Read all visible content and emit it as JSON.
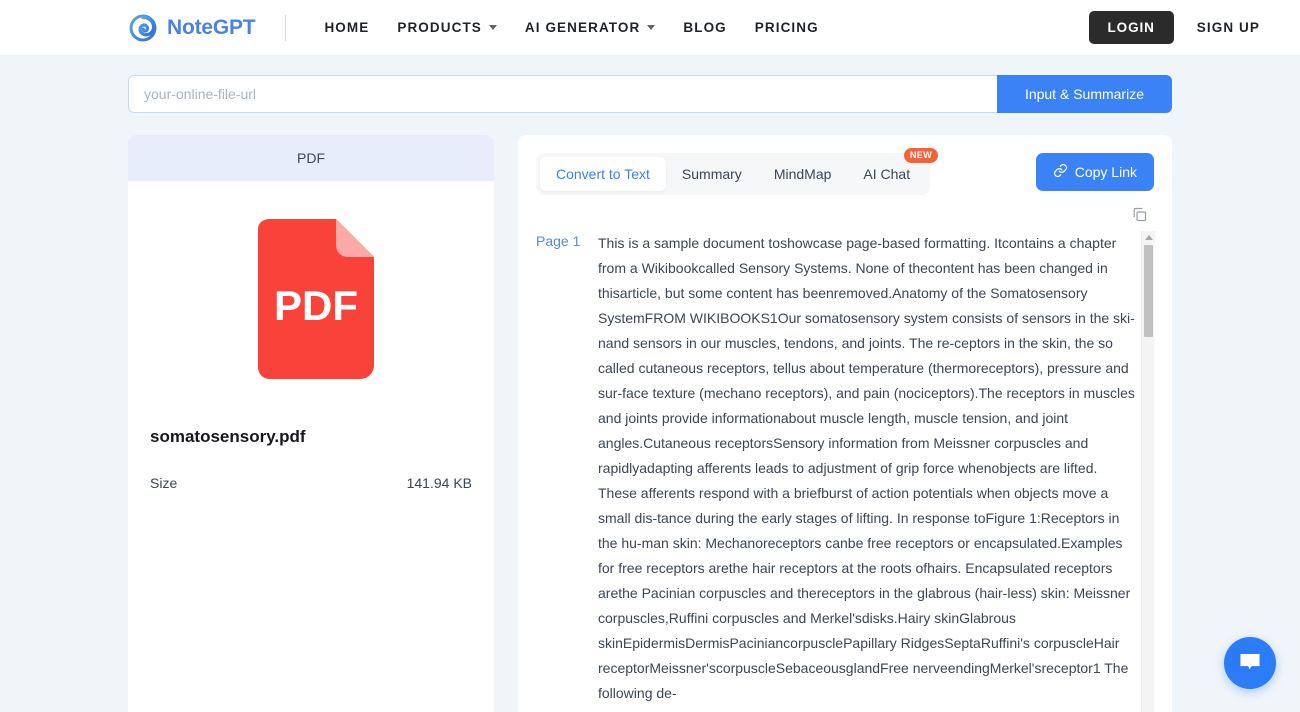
{
  "header": {
    "brand_name": "NoteGPT",
    "brand_icon": "spiral-logo-icon",
    "nav": [
      {
        "label": "HOME",
        "has_caret": false
      },
      {
        "label": "PRODUCTS",
        "has_caret": true
      },
      {
        "label": "AI GENERATOR",
        "has_caret": true
      },
      {
        "label": "BLOG",
        "has_caret": false
      },
      {
        "label": "PRICING",
        "has_caret": false
      }
    ],
    "login_label": "LOGIN",
    "signup_label": "SIGN UP",
    "accent_color": "#3b82f6",
    "login_bg": "#2b2b2b"
  },
  "urlbar": {
    "placeholder": "your-online-file-url",
    "value": "",
    "button_label": "Input & Summarize"
  },
  "file_card": {
    "type_label": "PDF",
    "icon_label": "PDF",
    "icon_color": "#f9423a",
    "file_name": "somatosensory.pdf",
    "size_label": "Size",
    "size_value": "141.94 KB"
  },
  "content": {
    "tabs": [
      {
        "label": "Convert to Text",
        "active": true,
        "badge": ""
      },
      {
        "label": "Summary",
        "active": false,
        "badge": ""
      },
      {
        "label": "MindMap",
        "active": false,
        "badge": ""
      },
      {
        "label": "AI Chat",
        "active": false,
        "badge": "NEW"
      }
    ],
    "copy_link_label": "Copy Link",
    "copy_link_icon": "link-icon",
    "copy_icon": "copy-icon",
    "page_label": "Page 1",
    "body_text": "This is a sample document toshowcase page-based formatting. Itcontains a chapter from a Wikibookcalled Sensory Systems. None of thecontent has been changed in thisarticle, but some content has beenremoved.Anatomy of the Somatosensory SystemFROM WIKIBOOKS1Our somatosensory system consists of sensors in the ski-nand sensors in our muscles, tendons, and joints. The re-ceptors in the skin, the so called cutaneous receptors, tellus about temperature (thermoreceptors), pressure and sur-face texture (mechano receptors), and pain (nociceptors).The receptors in muscles and joints provide informationabout muscle length, muscle tension, and joint angles.Cutaneous receptorsSensory information from Meissner corpuscles and rapidlyadapting afferents leads to adjustment of grip force whenobjects are lifted. These afferents respond with a briefburst of action potentials when objects move a small dis-tance during the early stages of lifting. In response toFigure 1:Receptors in the hu-man skin: Mechanoreceptors canbe free receptors or encapsulated.Examples for free receptors arethe hair receptors at the roots ofhairs. Encapsulated receptors arethe Pacinian corpuscles and thereceptors in the glabrous (hair-less) skin: Meissner corpuscles,Ruffini corpuscles and Merkel'sdisks.Hairy skinGlabrous skinEpidermisDermisPaciniancorpusclePapillary RidgesSeptaRuffini's corpuscleHair receptorMeissner'scorpuscleSebaceousglandFree nerveendingMerkel'sreceptor1 The following de-"
  },
  "chat_fab": {
    "icon": "chat-bubble-icon",
    "color": "#2b7cf6"
  }
}
